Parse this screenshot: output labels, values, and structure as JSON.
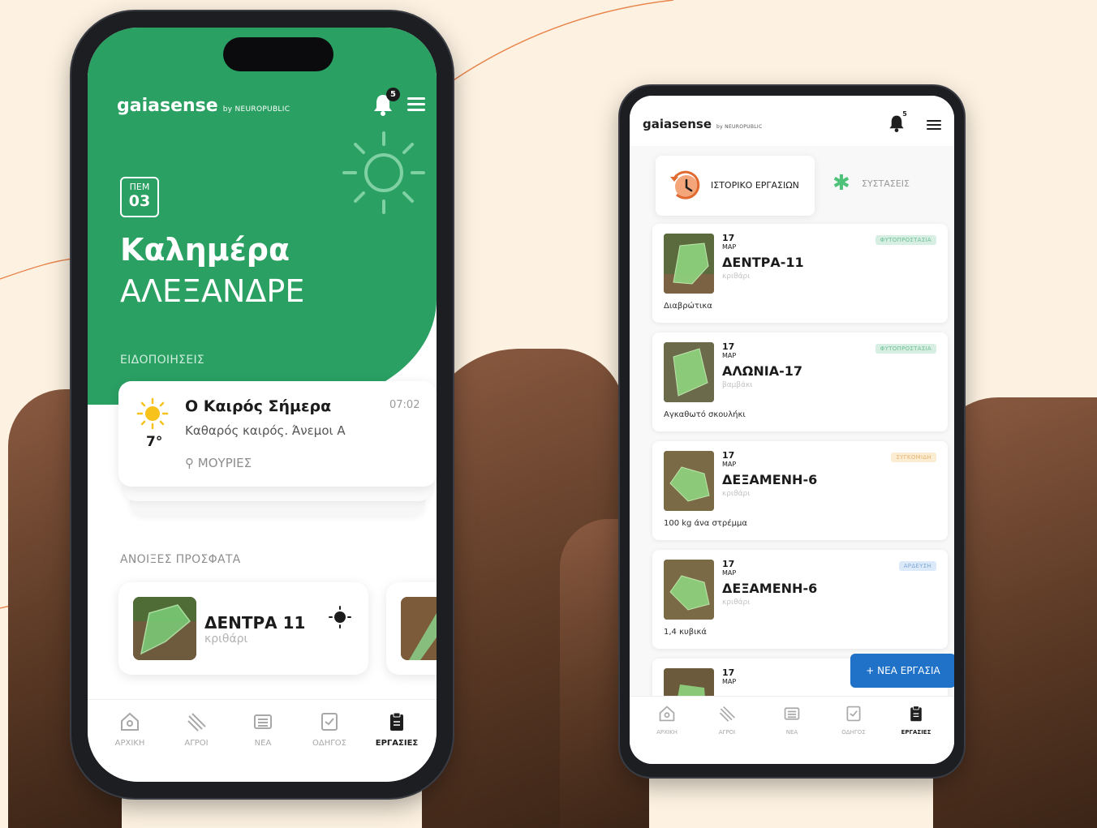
{
  "phone1": {
    "logo": "gaiasense",
    "logo_sub": "by NEUROPUBLIC",
    "notif_count": "5",
    "date": {
      "dow": "ΠΕΜ",
      "day": "03"
    },
    "greeting": "Καλημέρα",
    "user_name": "ΑΛΕΞΑΝΔΡΕ",
    "notifications_title": "ΕΙΔΟΠΟΙΗΣΕΙΣ",
    "weather_card": {
      "title": "Ο Καιρός Σήμερα",
      "time": "07:02",
      "description": "Καθαρός καιρός. Άνεμοι Α",
      "temperature": "7°",
      "location": "ΜΟΥΡΙΕΣ"
    },
    "recent_title": "ΑΝΟΙΞΕΣ ΠΡΟΣΦΑΤΑ",
    "recent_field": {
      "name": "ΔΕΝΤΡΑ 11",
      "crop": "κριθάρι"
    },
    "nav": [
      "ΑΡΧΙΚΗ",
      "ΑΓΡΟΙ",
      "ΝΕΑ",
      "ΟΔΗΓΟΣ",
      "ΕΡΓΑΣΙΕΣ"
    ]
  },
  "phone2": {
    "logo": "gaiasense",
    "logo_sub": "by NEUROPUBLIC",
    "notif_count": "5",
    "tabs": {
      "history": "ΙΣΤΟΡΙΚΟ ΕΡΓΑΣΙΩΝ",
      "recommendations": "ΣΥΣΤΑΣΕΙΣ"
    },
    "tasks": [
      {
        "day": "17",
        "month": "ΜΑΡ",
        "name": "ΔΕΝΤΡΑ-11",
        "crop": "κριθάρι",
        "tag": "ΦΥΤΟΠΡΟΣΤΑΣΙΑ",
        "note": "Διαβρώτικα"
      },
      {
        "day": "17",
        "month": "ΜΑΡ",
        "name": "ΑΛΩΝΙΑ-17",
        "crop": "βαμβάκι",
        "tag": "ΦΥΤΟΠΡΟΣΤΑΣΙΑ",
        "note": "Αγκαθωτό σκουλήκι"
      },
      {
        "day": "17",
        "month": "ΜΑΡ",
        "name": "ΔΕΞΑΜΕΝΗ-6",
        "crop": "κριθάρι",
        "tag": "ΣΥΓΚΟΜΙΔΗ",
        "note": "100 kg άνα στρέμμα"
      },
      {
        "day": "17",
        "month": "ΜΑΡ",
        "name": "ΔΕΞΑΜΕΝΗ-6",
        "crop": "κριθάρι",
        "tag": "ΑΡΔΕΥΣΗ",
        "note": "1,4 κυβικά"
      },
      {
        "day": "17",
        "month": "ΜΑΡ"
      }
    ],
    "fab": "+ ΝΕΑ ΕΡΓΑΣΙΑ",
    "nav": [
      "ΑΡΧΙΚΗ",
      "ΑΓΡΟΙ",
      "ΝΕΑ",
      "ΟΔΗΓΟΣ",
      "ΕΡΓΑΣΙΕΣ"
    ]
  },
  "colors": {
    "background": "#fdf2e2",
    "brand_green": "#2aa063",
    "tag_protection": "#d6efe2",
    "tag_harvest": "#fbecd4",
    "tag_irrigation": "#dbe9f8",
    "fab_blue": "#1f72c8"
  }
}
